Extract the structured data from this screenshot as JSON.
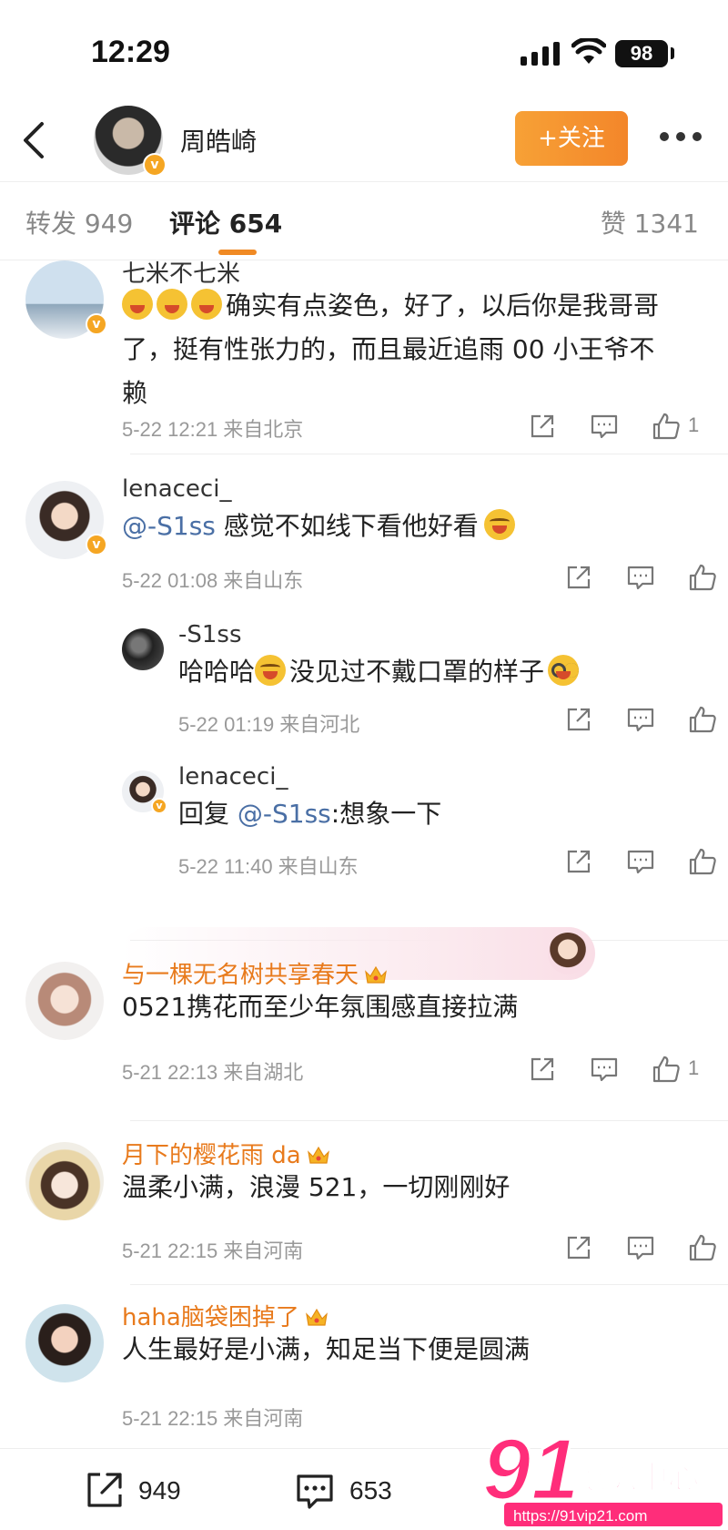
{
  "status_bar": {
    "time": "12:29",
    "battery": "98"
  },
  "header": {
    "name": "周皓崎",
    "follow_label": "+关注"
  },
  "tabs": {
    "repost": "转发 949",
    "comment": "评论 654",
    "likes": "赞 1341"
  },
  "comments": [
    {
      "name": "七米不七米",
      "text": "确实有点姿色，好了，以后你是我哥哥了，挺有性张力的，而且最近追雨 00 小王爷不赖",
      "meta": "5-22 12:21 来自北京",
      "likes": "1"
    },
    {
      "name": "lenaceci_",
      "mention": "@-S1ss",
      "text": " 感觉不如线下看他好看",
      "meta": "5-22 01:08 来自山东",
      "likes": ""
    },
    {
      "name": "-S1ss",
      "text_a": "哈哈哈",
      "text_b": "没见过不戴口罩的样子",
      "meta": "5-22 01:19 来自河北",
      "likes": ""
    },
    {
      "name": "lenaceci_",
      "prefix": "回复 ",
      "mention": "@-S1ss",
      "text": ":想象一下",
      "meta": "5-22 11:40 来自山东",
      "likes": ""
    },
    {
      "name": "与一棵无名树共享春天",
      "text": "0521携花而至少年氛围感直接拉满",
      "meta": "5-21 22:13 来自湖北",
      "likes": "1"
    },
    {
      "name": "月下的樱花雨 da",
      "text": "温柔小满，浪漫 521，一切刚刚好",
      "meta": "5-21 22:15 来自河南",
      "likes": ""
    },
    {
      "name": "haha脑袋困掉了",
      "text": "人生最好是小满，知足当下便是圆满",
      "meta": "5-21 22:15 来自河南",
      "likes": ""
    }
  ],
  "bottom_bar": {
    "reposts": "949",
    "comments": "653"
  },
  "watermark": {
    "brand": "91吃瓜中心",
    "url": "https://91vip21.com"
  },
  "colors": {
    "accent": "#f3862a",
    "mention": "#4a6fa5",
    "vip_name": "#e87a1c"
  }
}
